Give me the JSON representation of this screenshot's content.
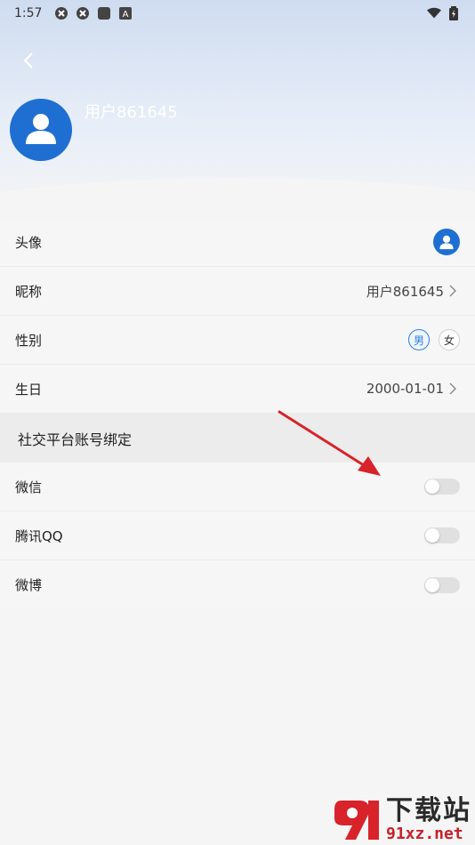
{
  "status_bar": {
    "time": "1:57",
    "icons": [
      "app-icon-1",
      "app-icon-2",
      "square-icon",
      "a-icon"
    ],
    "right_icons": [
      "wifi-icon",
      "battery-icon"
    ]
  },
  "header": {
    "back_icon": "chevron-left-icon",
    "username": "用户861645",
    "sub_line_1": "",
    "sub_line_2": ""
  },
  "rows": {
    "avatar": {
      "label": "头像"
    },
    "nickname": {
      "label": "昵称",
      "value": "用户861645"
    },
    "gender": {
      "label": "性别",
      "male": "男",
      "female": "女",
      "selected": "男"
    },
    "birthday": {
      "label": "生日",
      "value": "2000-01-01"
    }
  },
  "social": {
    "section_title": "社交平台账号绑定",
    "items": [
      {
        "label": "微信",
        "bound": false
      },
      {
        "label": "腾讯QQ",
        "bound": false
      },
      {
        "label": "微博",
        "bound": false
      }
    ]
  },
  "watermark": {
    "title": "下载站",
    "url": "91xz.net"
  },
  "colors": {
    "accent": "#2d7fe0",
    "avatar_blue": "#1f6fd2",
    "arrow_red": "#d8232a"
  }
}
